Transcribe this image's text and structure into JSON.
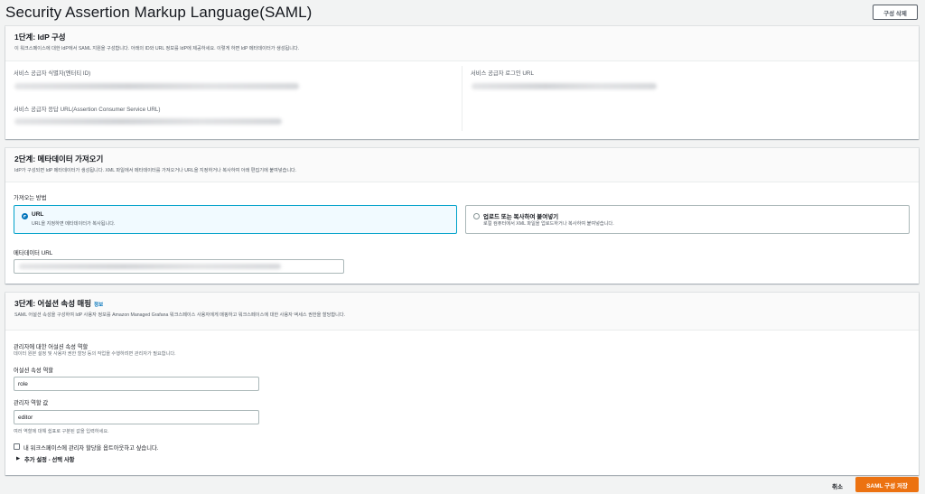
{
  "header": {
    "title": "Security Assertion Markup Language(SAML)",
    "delete_button": "구성 삭제"
  },
  "step1": {
    "title": "1단계: IdP 구성",
    "description": "이 워크스페이스에 대한 IdP에서 SAML 지원을 구성합니다. 아래의 ID와 URL 정보를 IdP에 제공하세요. 이렇게 하면 IdP 메타데이터가 생성됩니다.",
    "entity_id_label": "서비스 공급자 식별자(엔터티 ID)",
    "acs_url_label": "서비스 공급자 응답 URL(Assertion Consumer Service URL)",
    "login_url_label": "서비스 공급자 로그인 URL"
  },
  "step2": {
    "title": "2단계: 메타데이터 가져오기",
    "description": "IdP가 구성되면 IdP 메타데이터가 생성됩니다. XML 파일에서 메타데이터를 가져오거나 URL을 지정하거나 복사하여 아래 편집기에 붙여넣습니다.",
    "method_label": "가져오는 방법",
    "options": [
      {
        "title": "URL",
        "description": "URL을 지정하면 메타데이터가 복사됩니다.",
        "selected": true
      },
      {
        "title": "업로드 또는 복사하여 붙여넣기",
        "description": "로컬 컴퓨터에서 XML 파일을 업로드하거나 복사하여 붙여넣습니다.",
        "selected": false
      }
    ],
    "metadata_url_label": "메타데이터 URL"
  },
  "step3": {
    "title": "3단계: 어설션 속성 매핑",
    "info_link": "정보",
    "description": "SAML 어설션 속성을 구성하여 IdP 사용자 정보를 Amazon Managed Grafana 워크스페이스 사용자에게 매핑하고 워크스페이스에 대한 사용자 액세스 권한을 할당합니다.",
    "admin_role_section_title": "관리자에 대한 어설션 속성 역할",
    "admin_role_section_desc": "데이터 원본 설정 및 사용자 권한 할당 등의 작업을 수행하려면 관리자가 필요합니다.",
    "assertion_role_label": "어설션 속성 역할",
    "assertion_role_value": "role",
    "admin_role_values_label": "관리자 역할 값",
    "admin_role_values_value": "editor",
    "admin_role_values_hint": "여러 역할에 대해 쉼표로 구분된 값을 입력하세요.",
    "optout_label": "내 워크스페이스에 관리자 할당을 옵트아웃하고 싶습니다.",
    "additional_settings": "추가 설정 - 선택 사항"
  },
  "footer": {
    "cancel": "취소",
    "save": "SAML 구성 저장"
  },
  "colors": {
    "primary": "#ec7211",
    "link": "#0073bb",
    "selected_border": "#00a1c9"
  }
}
